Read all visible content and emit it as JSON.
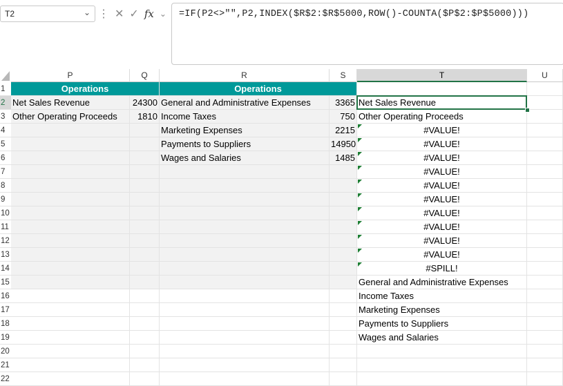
{
  "formula_bar": {
    "name_box": "T2",
    "formula": "=IF(P2<>\"\",P2,INDEX($R$2:$R$5000,ROW()-COUNTA($P$2:$P$5000)))"
  },
  "columns": [
    "P",
    "Q",
    "R",
    "S",
    "T",
    "U"
  ],
  "rows": [
    "1",
    "2",
    "3",
    "4",
    "5",
    "6",
    "7",
    "8",
    "9",
    "10",
    "11",
    "12",
    "13",
    "14",
    "15",
    "16",
    "17",
    "18",
    "19",
    "20",
    "21",
    "22"
  ],
  "headers": {
    "p1": "Operations",
    "r1": "Operations"
  },
  "colP": [
    "Net Sales Revenue",
    "Other Operating Proceeds"
  ],
  "colQ": [
    "24300",
    "1810"
  ],
  "colR": [
    "General and Administrative Expenses",
    "Income Taxes",
    "Marketing Expenses",
    "Payments to Suppliers",
    "Wages and Salaries"
  ],
  "colS": [
    "3365",
    "750",
    "2215",
    "14950",
    "1485"
  ],
  "colT": [
    "Net Sales Revenue",
    "Other Operating Proceeds",
    "#VALUE!",
    "#VALUE!",
    "#VALUE!",
    "#VALUE!",
    "#VALUE!",
    "#VALUE!",
    "#VALUE!",
    "#VALUE!",
    "#VALUE!",
    "#VALUE!",
    "#SPILL!",
    "General and Administrative Expenses",
    "Income Taxes",
    "Marketing Expenses",
    "Payments to Suppliers",
    "Wages and Salaries"
  ],
  "colors": {
    "header_teal": "#009999",
    "selection_green": "#217346",
    "shade": "#f2f2f2"
  }
}
